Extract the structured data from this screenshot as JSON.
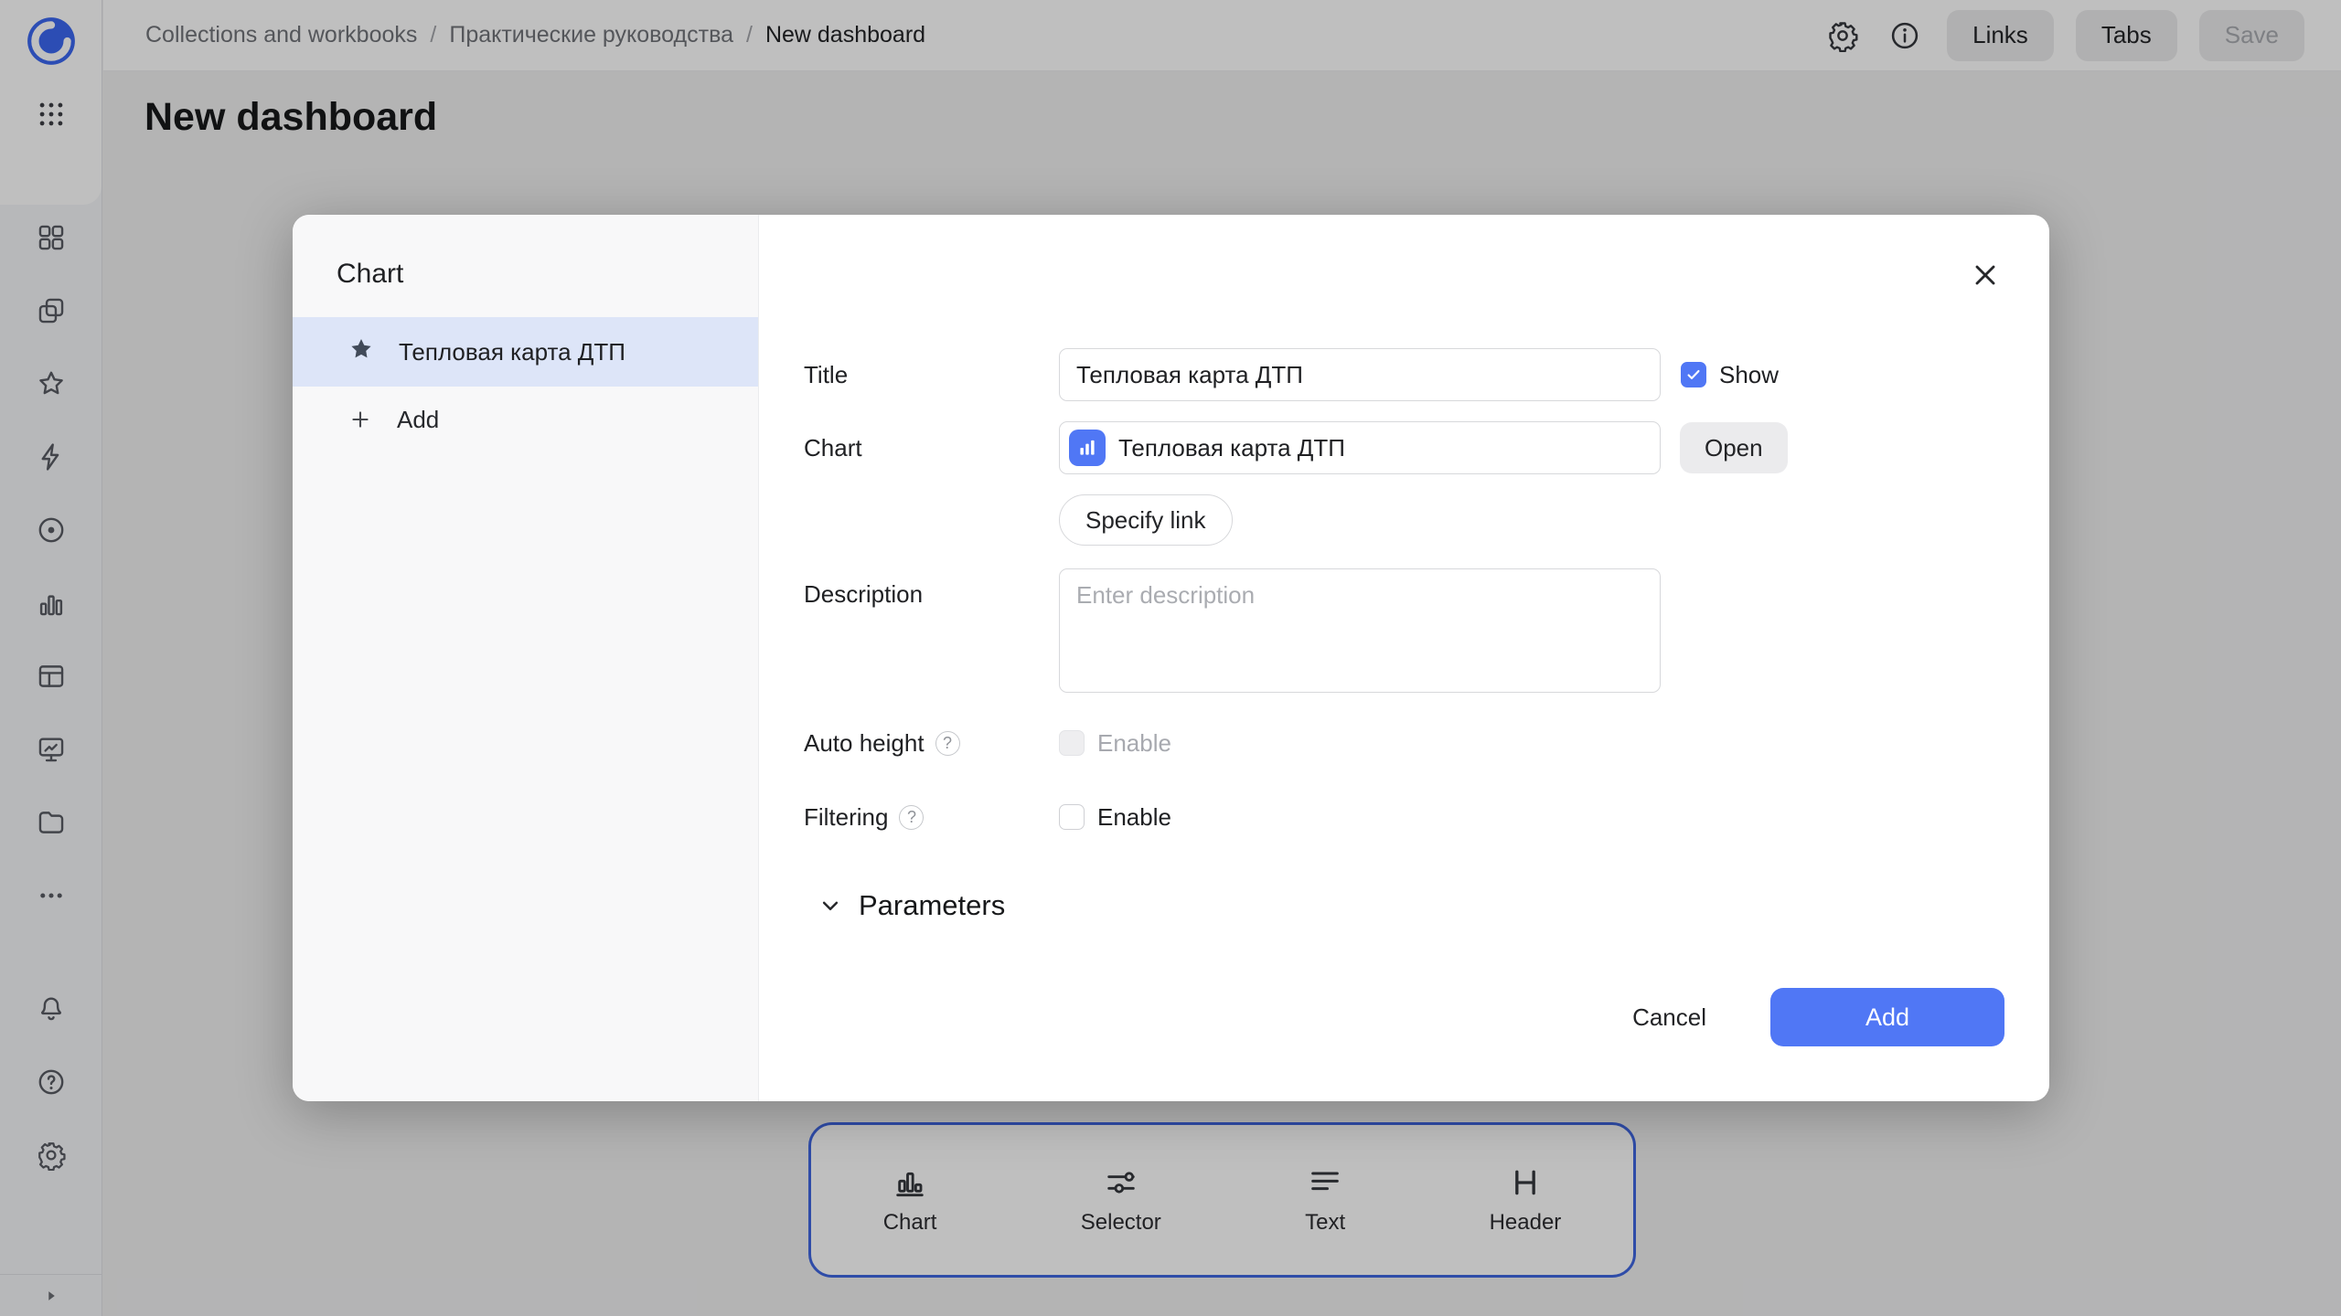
{
  "header": {
    "breadcrumbs": [
      "Collections and workbooks",
      "Практические руководства",
      "New dashboard"
    ],
    "separator": "/",
    "buttons": {
      "links": "Links",
      "tabs": "Tabs",
      "save": "Save"
    }
  },
  "page": {
    "title": "New dashboard"
  },
  "sidebar": {
    "icons": [
      "datalens-logo",
      "apps-grid-icon",
      "widgets-icon",
      "collections-icon",
      "favorites-icon",
      "quick-actions-icon",
      "monitoring-icon",
      "charts-icon",
      "tables-icon",
      "presentation-icon",
      "storage-icon",
      "more-icon",
      "notifications-bell-icon",
      "help-icon",
      "settings-gear-icon",
      "expand-icon"
    ]
  },
  "dialog": {
    "title": "Chart",
    "list": {
      "items": [
        {
          "label": "Тепловая карта ДТП",
          "selected": true
        }
      ],
      "add_label": "Add"
    },
    "form": {
      "title": {
        "label": "Title",
        "value": "Тепловая карта ДТП",
        "show_label": "Show",
        "show_checked": true
      },
      "chart": {
        "label": "Chart",
        "value": "Тепловая карта ДТП",
        "open_label": "Open",
        "specify_link_label": "Specify link"
      },
      "description": {
        "label": "Description",
        "placeholder": "Enter description",
        "value": ""
      },
      "auto_height": {
        "label": "Auto height",
        "enable_label": "Enable",
        "checked": false,
        "disabled": true
      },
      "filtering": {
        "label": "Filtering",
        "enable_label": "Enable",
        "checked": false
      },
      "parameters_label": "Parameters",
      "help_glyph": "?"
    },
    "footer": {
      "cancel": "Cancel",
      "add": "Add"
    }
  },
  "toolbar": {
    "items": [
      {
        "icon": "chart-icon",
        "label": "Chart"
      },
      {
        "icon": "selector-icon",
        "label": "Selector"
      },
      {
        "icon": "text-icon",
        "label": "Text"
      },
      {
        "icon": "header-icon",
        "label": "Header"
      }
    ]
  },
  "colors": {
    "accent": "#5077f5",
    "toolbar_border": "#3f66e0",
    "selected_row": "#dde5f8"
  }
}
